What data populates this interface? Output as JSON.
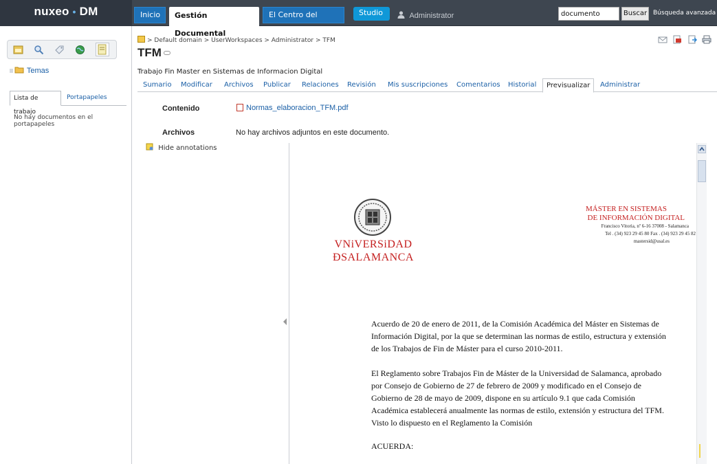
{
  "app": {
    "logo_main": "nuxeo",
    "logo_dot": "•",
    "logo_suffix": "DM"
  },
  "topnav": {
    "tabs": [
      "Inicio",
      "Gestión Documental",
      "El Centro del Admin",
      "Studio"
    ],
    "user": "Administrator",
    "search_value": "documento",
    "search_button": "Buscar",
    "advanced_search": "Búsqueda avanzada"
  },
  "sidebar": {
    "tree_item": "Temas",
    "tabs": [
      "Lista de trabajo",
      "Portapapeles"
    ],
    "empty_message": "No hay documentos en el portapapeles"
  },
  "breadcrumb": "> Default domain > UserWorkspaces > Administrator > TFM",
  "document": {
    "title": "TFM",
    "description": "Trabajo Fin Master en Sistemas de Informacion Digital",
    "tabs": [
      "Sumario",
      "Modificar",
      "Archivos",
      "Publicar",
      "Relaciones",
      "Revisión",
      "Mis suscripciones",
      "Comentarios",
      "Historial",
      "Previsualizar",
      "Administrar"
    ],
    "active_tab": "Previsualizar",
    "content_label": "Contenido",
    "content_file": "Normas_elaboracion_TFM.pdf",
    "files_label": "Archivos",
    "files_text": "No hay archivos adjuntos en este documento.",
    "hide_annotations": "Hide annotations"
  },
  "preview": {
    "uni_line1": "VNiVERSiDAD",
    "uni_line2": "ÐSALAMANCA",
    "master_line1": "MÁSTER EN SISTEMAS",
    "master_line2": "DE INFORMACIÓN DIGITAL",
    "address": "Francisco Vitoria, nº 6-16 37008 - Salamanca",
    "phone": "Tel . (34) 923 29 45 80 Fax . (34) 923 29 45 82",
    "email": "mastersid@usal.es",
    "para1": "Acuerdo de 20 de enero de 2011, de la Comisión Académica del Máster en Sistemas de Información Digital, por la que se determinan las normas de estilo, estructura y extensión de los Trabajos de Fin de Máster para el curso 2010-2011.",
    "para2": "El Reglamento sobre Trabajos Fin de Máster de la Universidad de Salamanca, aprobado por Consejo de Gobierno de 27 de febrero de 2009 y modificado en el Consejo de Gobierno de 28 de mayo de 2009, dispone en su artículo 9.1 que cada Comisión Académica establecerá anualmente las normas de estilo, extensión y estructura del TFM. Visto lo dispuesto en el Reglamento la Comisión",
    "para3": "ACUERDA:"
  },
  "colors": {
    "topbar": "#3e4650",
    "nav_blue": "#1f72b8",
    "studio_blue": "#0f98d8",
    "link": "#1a5fa6",
    "usal_red": "#c41e1e"
  }
}
